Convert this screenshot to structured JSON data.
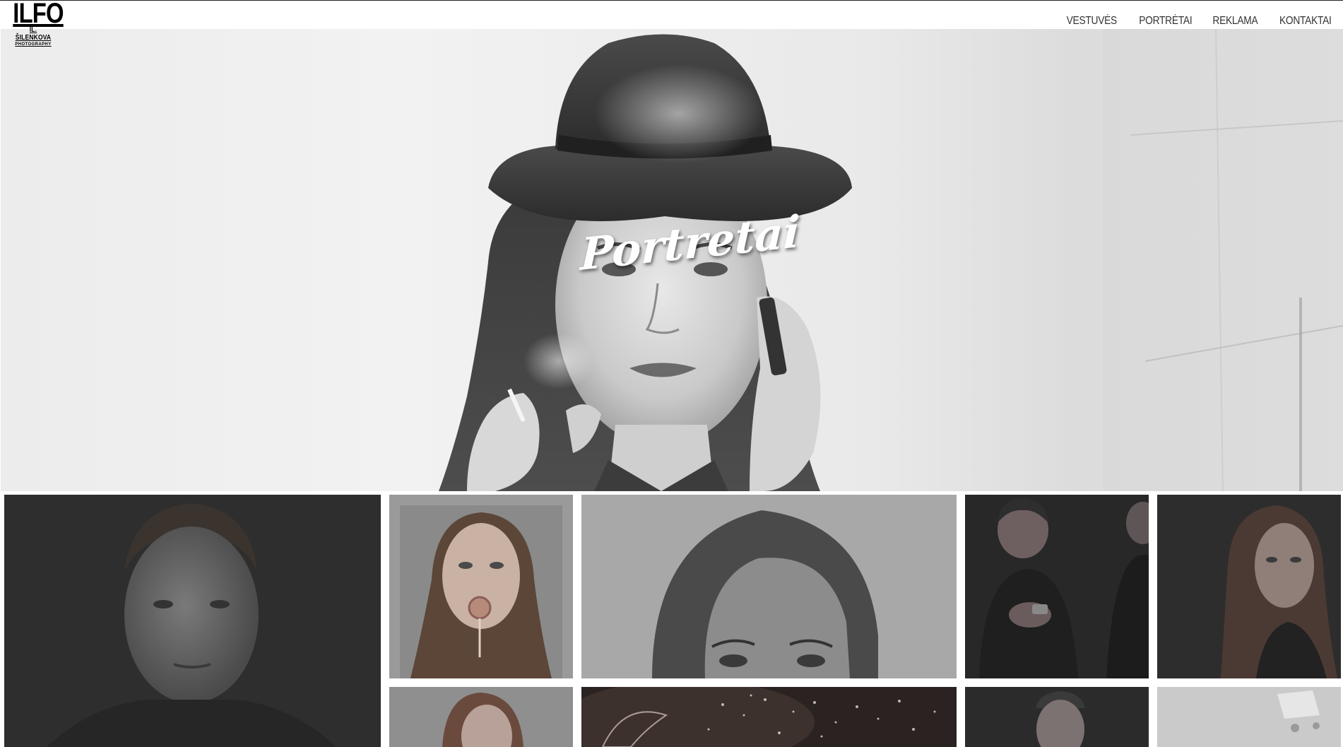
{
  "logo": {
    "main": "ILFO",
    "sub": "IL. ŠILENKOVA",
    "tag": "PHOTOGRAPHY"
  },
  "nav": {
    "items": [
      {
        "label": "VESTUVĖS"
      },
      {
        "label": "PORTRĖTAI"
      },
      {
        "label": "REKLAMA"
      },
      {
        "label": "KONTAKTAI"
      }
    ]
  },
  "hero": {
    "title": "Portretai"
  },
  "colors": {
    "header_bg": "#ffffff",
    "nav_text": "#333333",
    "hero_title": "#ffffff"
  }
}
